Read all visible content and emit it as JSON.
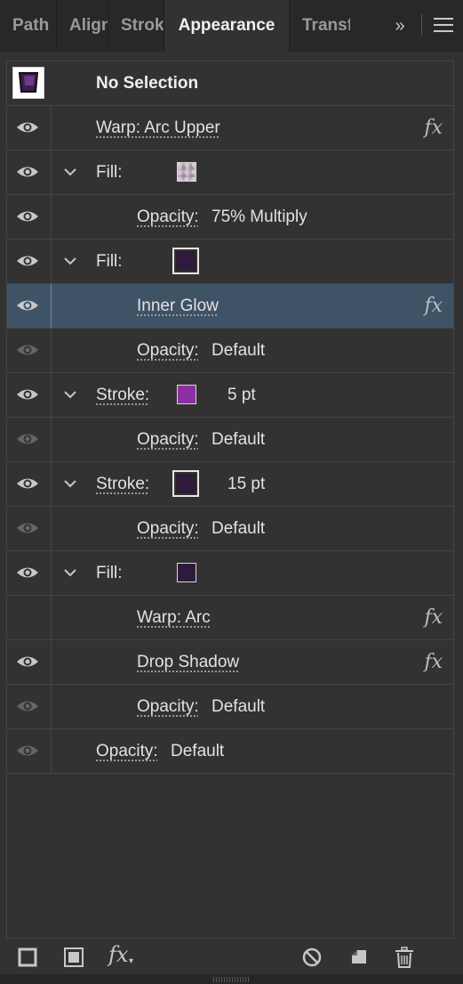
{
  "tabs": [
    {
      "label": "Path"
    },
    {
      "label": "Align"
    },
    {
      "label": "Stroke"
    },
    {
      "label": "Appearance"
    },
    {
      "label": "Transform"
    }
  ],
  "tab_overflow_label": "»",
  "header": {
    "title": "No Selection",
    "thumbnail_color": "#3a1d4d"
  },
  "rows": [
    {
      "label": "Warp: Arc Upper"
    },
    {
      "label": "Fill:",
      "swatch": "pattern"
    },
    {
      "label": "Opacity:",
      "value": "75% Multiply"
    },
    {
      "label": "Fill:",
      "swatch": "#2f1a3d"
    },
    {
      "label": "Inner Glow"
    },
    {
      "label": "Opacity:",
      "value": "Default"
    },
    {
      "label": "Stroke:",
      "swatch": "#8b2fa3",
      "value": "5 pt"
    },
    {
      "label": "Opacity:",
      "value": "Default"
    },
    {
      "label": "Stroke:",
      "swatch": "#2f1a3d",
      "value": "15 pt"
    },
    {
      "label": "Opacity:",
      "value": "Default"
    },
    {
      "label": "Fill:",
      "swatch": "#2f1a3d"
    },
    {
      "label": "Warp: Arc"
    },
    {
      "label": "Drop Shadow"
    },
    {
      "label": "Opacity:",
      "value": "Default"
    },
    {
      "label": "Opacity:",
      "value": "Default"
    }
  ],
  "fx_symbol": "fx",
  "colors": {
    "panel_bg": "#323232",
    "selected_row": "#3f5367",
    "accent_purple": "#8b2fa3",
    "dark_purple": "#2f1a3d"
  },
  "toolbar": {
    "icons": [
      "add-stroke-icon",
      "add-fill-icon",
      "fx-menu-icon",
      "clear-appearance-icon",
      "duplicate-item-icon",
      "delete-item-icon"
    ],
    "fx_label": "fx"
  }
}
